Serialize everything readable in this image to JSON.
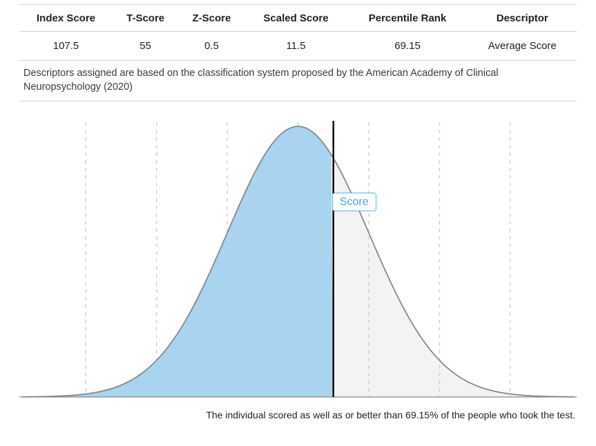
{
  "table": {
    "headers": [
      "Index Score",
      "T-Score",
      "Z-Score",
      "Scaled Score",
      "Percentile Rank",
      "Descriptor"
    ],
    "row": {
      "index_score": "107.5",
      "t_score": "55",
      "z_score": "0.5",
      "scaled_score": "11.5",
      "percentile_rank": "69.15",
      "descriptor": "Average Score"
    },
    "footnote": "Descriptors assigned are based on the classification system proposed by the American Academy of Clinical Neuropsychology (2020)"
  },
  "chart_data": {
    "type": "area",
    "description": "Normal distribution (bell curve) with area to the left of the score shaded",
    "z_score_marker": 0.5,
    "percentile_shaded": 69.15,
    "marker_label": "Score",
    "curve_color": "#888888",
    "shade_color": "#a8d4ef",
    "background_color": "#f3f3f3",
    "grid_dashes_z": [
      -3,
      -2,
      -1,
      0,
      1,
      2,
      3
    ],
    "x_range_z": [
      -3.9,
      3.9
    ]
  },
  "interpretation": "The individual scored as well as or better than 69.15% of the people who took the test."
}
